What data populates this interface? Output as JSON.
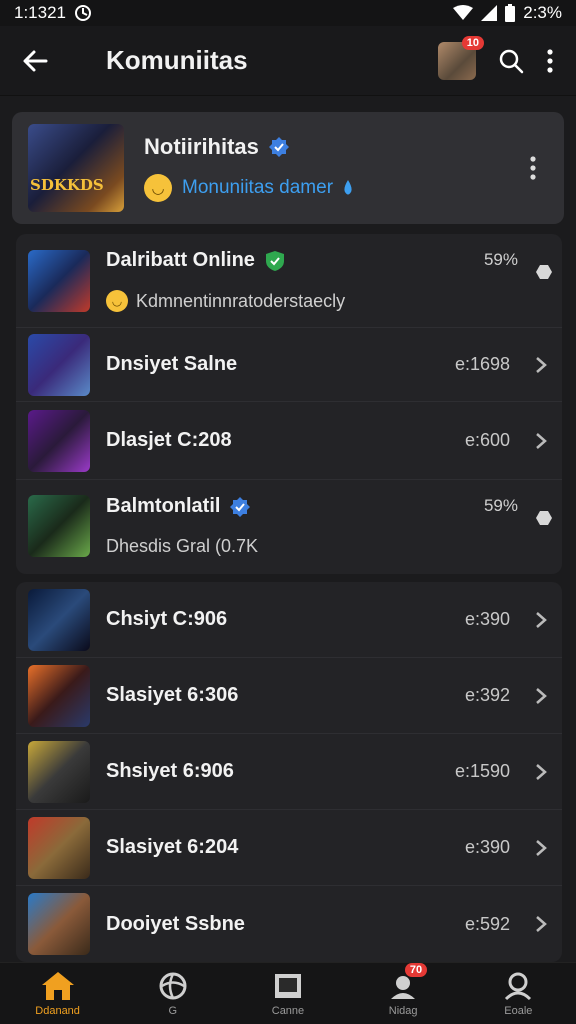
{
  "status": {
    "time": "1:1321",
    "battery": "2:3%"
  },
  "header": {
    "title": "Komuniitas",
    "avatar_badge": "10"
  },
  "featured": {
    "title": "Notiirihitas",
    "thumb_text": "SDKKDS",
    "subtitle": "Monuniitas damer"
  },
  "list1": [
    {
      "title": "Dalribatt Online",
      "subtitle": "Kdmnentinnratoderstaecly",
      "value": "59%",
      "verified": "green",
      "type": "dot"
    },
    {
      "title": "Dnsiyet Salne",
      "value": "e:1698",
      "type": "chevron"
    },
    {
      "title": "Dlasjet C:208",
      "value": "e:600",
      "type": "chevron"
    },
    {
      "title": "Balmtonlatil",
      "subtitle": "Dhesdis Gral (0.7K",
      "value": "59%",
      "verified": "blue",
      "type": "dot"
    }
  ],
  "list2": [
    {
      "title": "Chsiyt C:906",
      "value": "e:390"
    },
    {
      "title": "Slasiyet 6:306",
      "value": "e:392"
    },
    {
      "title": "Shsiyet 6:906",
      "value": "e:1590"
    },
    {
      "title": "Slasiyet 6:204",
      "value": "e:390"
    },
    {
      "title": "Dooiyet Ssbne",
      "value": "e:592"
    }
  ],
  "nav": [
    {
      "label": "Ddanand",
      "icon": "home-icon"
    },
    {
      "label": "G",
      "icon": "basketball-icon"
    },
    {
      "label": "Canne",
      "icon": "square-icon"
    },
    {
      "label": "Nidag",
      "icon": "group-icon",
      "badge": "70"
    },
    {
      "label": "Eoale",
      "icon": "profile-icon"
    }
  ],
  "colors": {
    "accent": "#3d9ff0",
    "badge": "#e53935",
    "active": "#f0a020"
  }
}
